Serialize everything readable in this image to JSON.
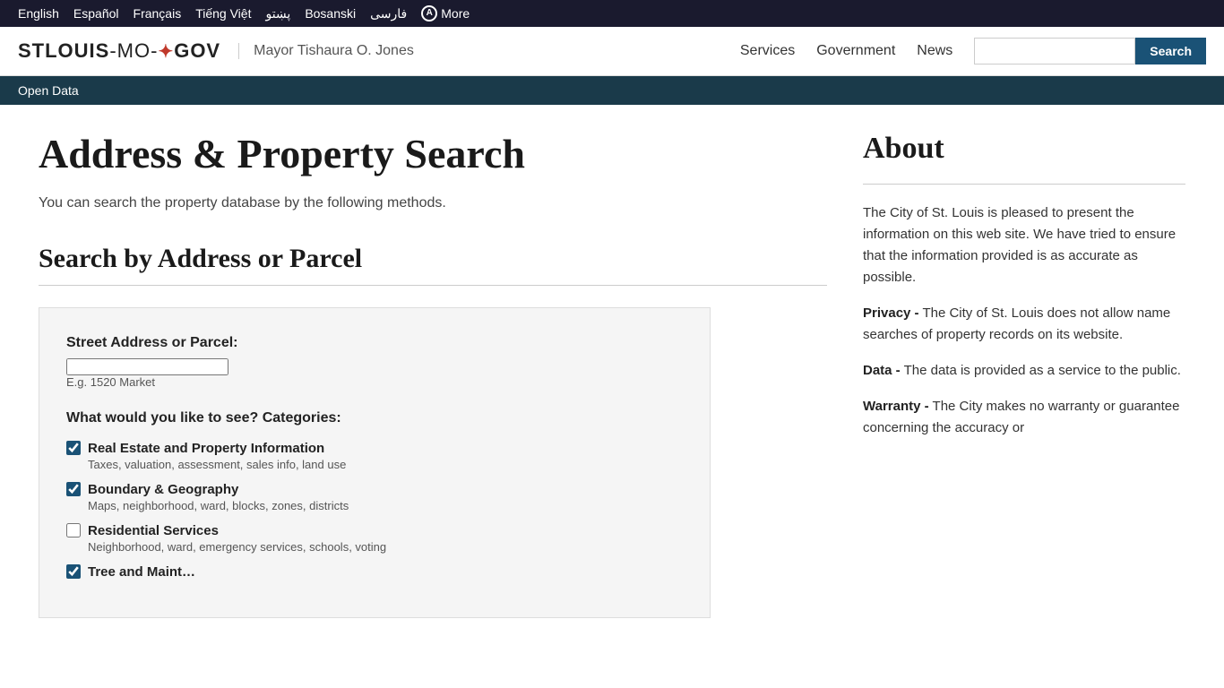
{
  "lang_bar": {
    "languages": [
      {
        "label": "English",
        "active": true
      },
      {
        "label": "Español"
      },
      {
        "label": "Français"
      },
      {
        "label": "Tiếng Việt"
      },
      {
        "label": "پښتو"
      },
      {
        "label": "Bosanski"
      },
      {
        "label": "فارسی"
      }
    ],
    "more_label": "More"
  },
  "header": {
    "logo_part1": "STLOUIS",
    "logo_sep": "-MO-",
    "logo_part2": "GOV",
    "mayor": "Mayor Tishaura O. Jones",
    "nav": {
      "services": "Services",
      "government": "Government",
      "news": "News",
      "search_placeholder": "",
      "search_button": "Search"
    }
  },
  "breadcrumb": "Open Data",
  "page": {
    "title": "Address & Property Search",
    "subtitle": "You can search the property database by the following methods.",
    "section_title": "Search by Address or Parcel",
    "form": {
      "address_label": "Street Address or Parcel:",
      "address_value": "",
      "address_example": "E.g. 1520 Market",
      "categories_label": "What would you like to see? Categories:",
      "categories": [
        {
          "id": "cat1",
          "label": "Real Estate and Property Information",
          "desc": "Taxes, valuation, assessment, sales info, land use",
          "checked": true
        },
        {
          "id": "cat2",
          "label": "Boundary & Geography",
          "desc": "Maps, neighborhood, ward, blocks, zones, districts",
          "checked": true
        },
        {
          "id": "cat3",
          "label": "Residential Services",
          "desc": "Neighborhood, ward, emergency services, schools, voting",
          "checked": false
        },
        {
          "id": "cat4",
          "label": "Tree and Maint…",
          "desc": "",
          "checked": true
        }
      ]
    }
  },
  "sidebar": {
    "about_title": "About",
    "intro": "The City of St. Louis is pleased to present the information on this web site. We have tried to ensure that the information provided is as accurate as possible.",
    "privacy_label": "Privacy -",
    "privacy_text": " The City of St. Louis does not allow name searches of property records on its website.",
    "data_label": "Data -",
    "data_text": " The data is provided as a service to the public.",
    "warranty_label": "Warranty -",
    "warranty_text": " The City makes no warranty or guarantee concerning the accuracy or"
  }
}
